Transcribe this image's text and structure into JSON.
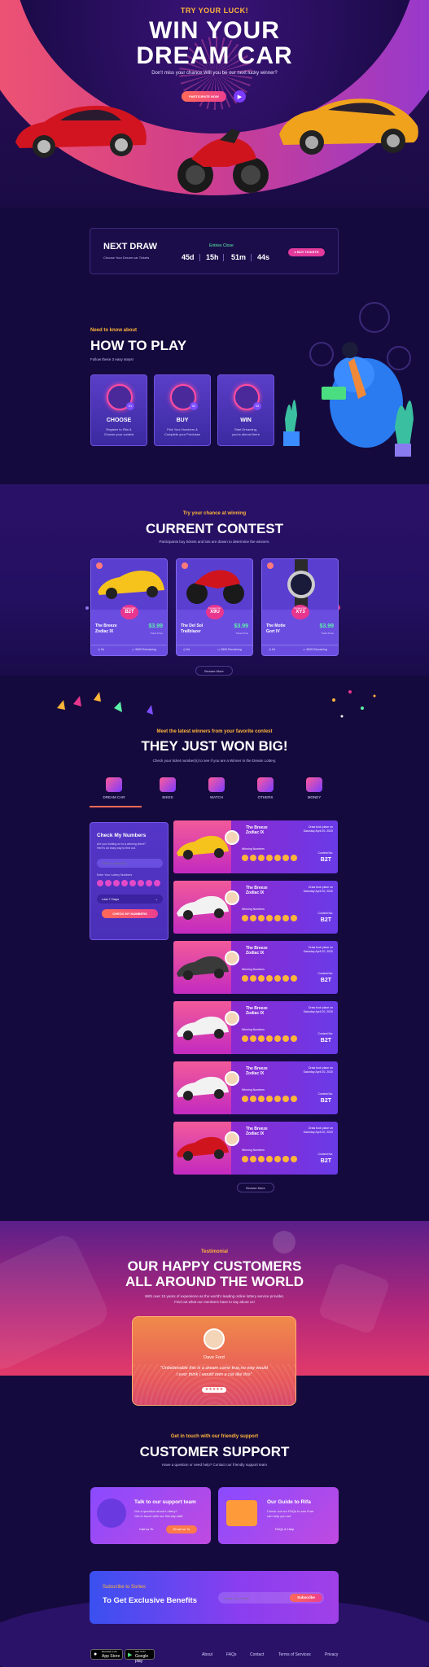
{
  "hero": {
    "kicker": "TRY YOUR LUCK!",
    "title_line1": "WIN YOUR",
    "title_line2": "DREAM CAR",
    "subtitle": "Don't miss your chance.Will you be our next lucky winner?",
    "cta": "PARTICIPATE NOW"
  },
  "draw": {
    "title": "NEXT DRAW",
    "subtitle": "Choose Your Dream car Tickets",
    "entries_label": "Entries Close",
    "days": "45d",
    "hours": "15h",
    "minutes": "51m",
    "seconds": "44s",
    "buy_label": "BUY TICKETS"
  },
  "how_to_play": {
    "kicker": "Need to know about",
    "title": "HOW TO PLAY",
    "subtitle": "Follow these 3 easy steps!",
    "steps": [
      {
        "num": "01",
        "title": "CHOOSE",
        "line1": "Register to Rifa &",
        "line2": "Choose your contest"
      },
      {
        "num": "02",
        "title": "BUY",
        "line1": "Pick Your Numbers &",
        "line2": "Complete your Purchase"
      },
      {
        "num": "03",
        "title": "WIN",
        "line1": "Start Dreaming,",
        "line2": "you're almost there"
      }
    ]
  },
  "contest": {
    "kicker": "Try your chance at winning",
    "title": "CURRENT CONTEST",
    "subtitle": "Participants buy tickets and lots are drawn to determine the winners.",
    "cards": [
      {
        "contest_label": "Contest No:",
        "contest_no": "B2T",
        "name1": "The Breeze",
        "name2": "Zodiac IX",
        "price": "$3.99",
        "ticket": "Ticket Price",
        "days": "5d",
        "remaining": "9805 Remaining"
      },
      {
        "contest_label": "Contest No:",
        "contest_no": "X9U",
        "name1": "The Del Sol",
        "name2": "Trailblazer",
        "price": "$3.99",
        "ticket": "Ticket Price",
        "days": "5d",
        "remaining": "9805 Remaining"
      },
      {
        "contest_label": "Contest No:",
        "contest_no": "XY3",
        "name1": "The Motte",
        "name2": "Gort IV",
        "price": "$3.99",
        "ticket": "Ticket Price",
        "days": "5d",
        "remaining": "9805 Remaining"
      }
    ],
    "browse": "Browse More"
  },
  "winners": {
    "kicker": "Meet the latest winners from your favorite contest",
    "title": "THEY JUST WON BIG!",
    "subtitle": "Check your ticket number(s) to see if you are a Winner in the Dream Lottery.",
    "tabs": [
      "DREAM CAR",
      "BIKES",
      "WATCH",
      "OTHERS",
      "MONEY"
    ],
    "check": {
      "title": "Check My Numbers",
      "desc1": "Are you holding on to a winning ticket?",
      "desc2": "Here's an easy way to find out.",
      "placeholder": "Enter Contest No",
      "numbers_label": "Enter Your Lottery Numbers",
      "period": "Last 7 Days",
      "button": "CHECK MY NUMBERS"
    },
    "row": {
      "name1": "The Breeze",
      "name2": "Zodiac IX",
      "draw_label": "Draw took place on",
      "draw_date": "Saturday April 20, 2020",
      "numbers_label": "Winning Numbers",
      "contest_label": "Contest No:",
      "contest_no": "B2T"
    },
    "browse": "Browse More"
  },
  "testimonial": {
    "kicker": "Testimonial",
    "title1": "OUR HAPPY CUSTOMERS",
    "title2": "ALL AROUND THE WORLD",
    "sub1": "With over 10 years of experience as the world's leading online lottery service provider,",
    "sub2": "Find out what our members have to say about us!",
    "name": "Dave Ford",
    "quote1": "\"Unbelievable this is a dream come true,no way would",
    "quote2": "I ever think I would own a car like this\""
  },
  "support": {
    "kicker": "Get in touch with our friendly support",
    "title": "CUSTOMER SUPPORT",
    "subtitle": "Have a question or need help? Contact our friendly support team",
    "team_title": "Talk to our support team",
    "team_desc1": "Got a question about Lottery?",
    "team_desc2": "Get in touch with our friendly staff",
    "call": "Call us To",
    "email": "Email us To",
    "guide_title": "Our Guide to Rifa",
    "guide_desc1": "Check out our FAQs to see if we",
    "guide_desc2": "can help you out",
    "faqs": "FAQs & Help"
  },
  "subscribe": {
    "kicker": "Subscribe to Sorteo",
    "title": "To Get Exclusive Benefits",
    "placeholder": "Enter Your Email",
    "button": "Subscribe"
  },
  "footer": {
    "app_store": "App Store",
    "app_store_small": "Download on the",
    "google_play": "Google play",
    "google_small": "GET IT ON",
    "links": [
      "About",
      "FAQs",
      "Contact",
      "Terms of Services",
      "Privacy"
    ]
  }
}
